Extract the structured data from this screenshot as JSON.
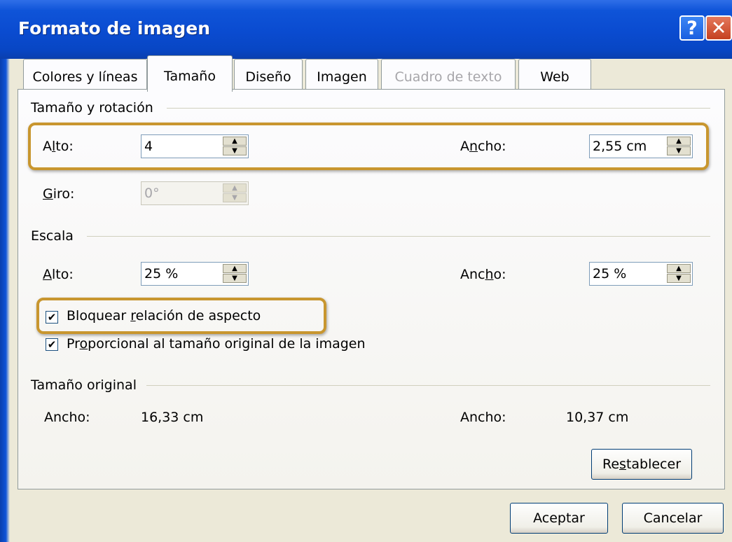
{
  "window": {
    "title": "Formato de imagen",
    "help_glyph": "?",
    "close_glyph": "✕"
  },
  "tabs": [
    {
      "label": "Colores y líneas",
      "state": "normal"
    },
    {
      "label": "Tamaño",
      "state": "active"
    },
    {
      "label": "Diseño",
      "state": "normal"
    },
    {
      "label": "Imagen",
      "state": "normal"
    },
    {
      "label": "Cuadro de texto",
      "state": "disabled"
    },
    {
      "label": "Web",
      "state": "normal"
    }
  ],
  "size_rotation": {
    "section_label": "Tamaño y rotación",
    "alto": {
      "label_pre": "A",
      "label_u": "l",
      "label_post": "to:",
      "value": "4"
    },
    "ancho": {
      "label_pre": "A",
      "label_u": "n",
      "label_post": "cho:",
      "value": "2,55 cm"
    },
    "giro": {
      "label_pre": "",
      "label_u": "G",
      "label_post": "iro:",
      "value": "0°"
    }
  },
  "scale": {
    "section_label": "Escala",
    "alto": {
      "label_pre": "",
      "label_u": "A",
      "label_post": "lto:",
      "value": "25 %"
    },
    "ancho": {
      "label_pre": "Anc",
      "label_u": "h",
      "label_post": "o:",
      "value": "25 %"
    },
    "lock_aspect": {
      "label_pre": "Bloquear ",
      "label_u": "r",
      "label_post": "elación de aspecto",
      "checked": true
    },
    "relative_original": {
      "label_pre": "Pr",
      "label_u": "o",
      "label_post": "porcional al tamaño original de la imagen",
      "checked": true
    }
  },
  "original_size": {
    "section_label": "Tamaño original",
    "ancho1_label": "Ancho:",
    "ancho1_value": "16,33 cm",
    "ancho2_label": "Ancho:",
    "ancho2_value": "10,37 cm"
  },
  "buttons": {
    "reset_pre": "Re",
    "reset_u": "s",
    "reset_post": "tablecer",
    "ok": "Aceptar",
    "cancel": "Cancelar"
  },
  "checkmark": "✔",
  "colors": {
    "titlebar": "#0a4bd0",
    "highlight": "#c8962f",
    "dialog_bg": "#ece9d8"
  }
}
